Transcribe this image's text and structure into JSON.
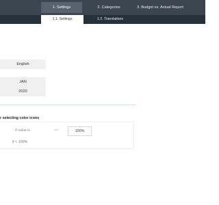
{
  "tabs": [
    {
      "label": "1. Settings",
      "active": true
    },
    {
      "label": "2. Categories",
      "active": false
    },
    {
      "label": "3. Budget vs. Actual Report",
      "active": false
    }
  ],
  "subtabs": [
    {
      "label": "1.1. Settings",
      "active": true
    },
    {
      "label": "1.2. Translations",
      "active": false
    }
  ],
  "settings": {
    "language": "English",
    "month": "JAN",
    "year": "2020"
  },
  "color_icons": {
    "title": "r selecting color icons",
    "if_label": "If value is",
    "operator_upper": ">=",
    "threshold_upper": "100%",
    "operator_lower": "if <",
    "threshold_lower": "100%"
  },
  "colors": {
    "topbar": "#3c4650",
    "subbar": "#27313a",
    "active_tab": "#566270",
    "value_box": "#f0f0f0",
    "divider": "#cde3e6"
  }
}
